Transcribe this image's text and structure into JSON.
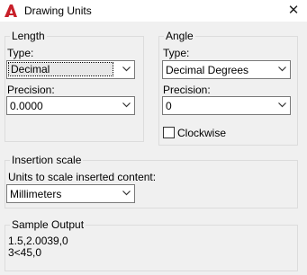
{
  "window": {
    "title": "Drawing Units",
    "close_glyph": "✕",
    "icon": "autocad-a-icon",
    "accent_color": "#c8202a"
  },
  "length": {
    "group_label": "Length",
    "type_label": "Type:",
    "type_value": "Decimal",
    "precision_label": "Precision:",
    "precision_value": "0.0000"
  },
  "angle": {
    "group_label": "Angle",
    "type_label": "Type:",
    "type_value": "Decimal Degrees",
    "precision_label": "Precision:",
    "precision_value": "0",
    "clockwise_label": "Clockwise",
    "clockwise_checked": false
  },
  "insertion": {
    "group_label": "Insertion scale",
    "units_label": "Units to scale inserted content:",
    "units_value": "Millimeters"
  },
  "sample": {
    "group_label": "Sample Output",
    "line1": "1.5,2.0039,0",
    "line2": "3<45,0"
  }
}
